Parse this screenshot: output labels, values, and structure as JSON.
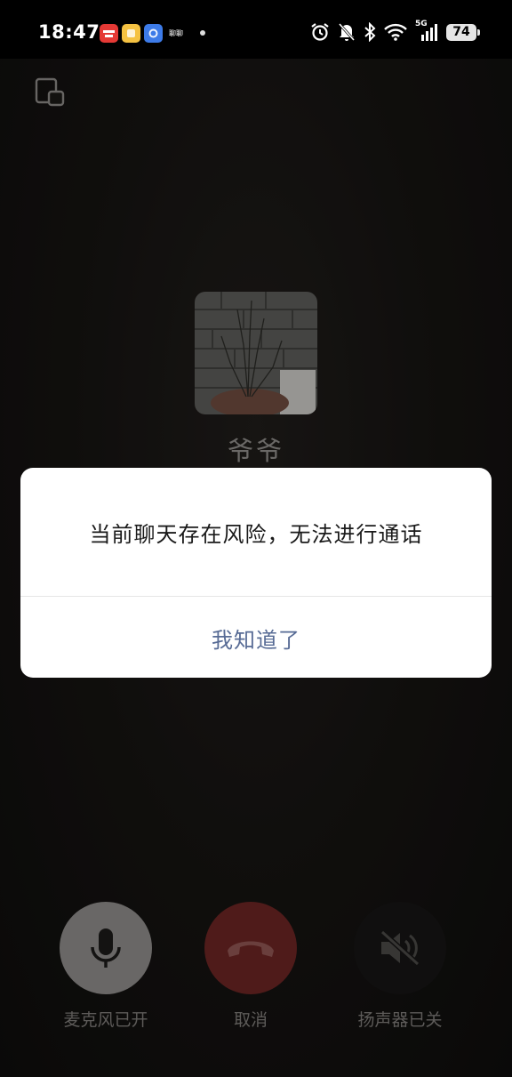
{
  "status_bar": {
    "time": "18:47",
    "app_badge_text": "聊聊",
    "network": "5G",
    "battery": "74"
  },
  "caller": {
    "name": "爷爷"
  },
  "dialog": {
    "message": "当前聊天存在风险，无法进行通话",
    "confirm_label": "我知道了"
  },
  "controls": {
    "mic_label": "麦克风已开",
    "cancel_label": "取消",
    "speaker_label": "扬声器已关"
  },
  "colors": {
    "cancel_button": "#6a2523",
    "dialog_button_text": "#576b95",
    "mic_button": "#8c8a88"
  }
}
